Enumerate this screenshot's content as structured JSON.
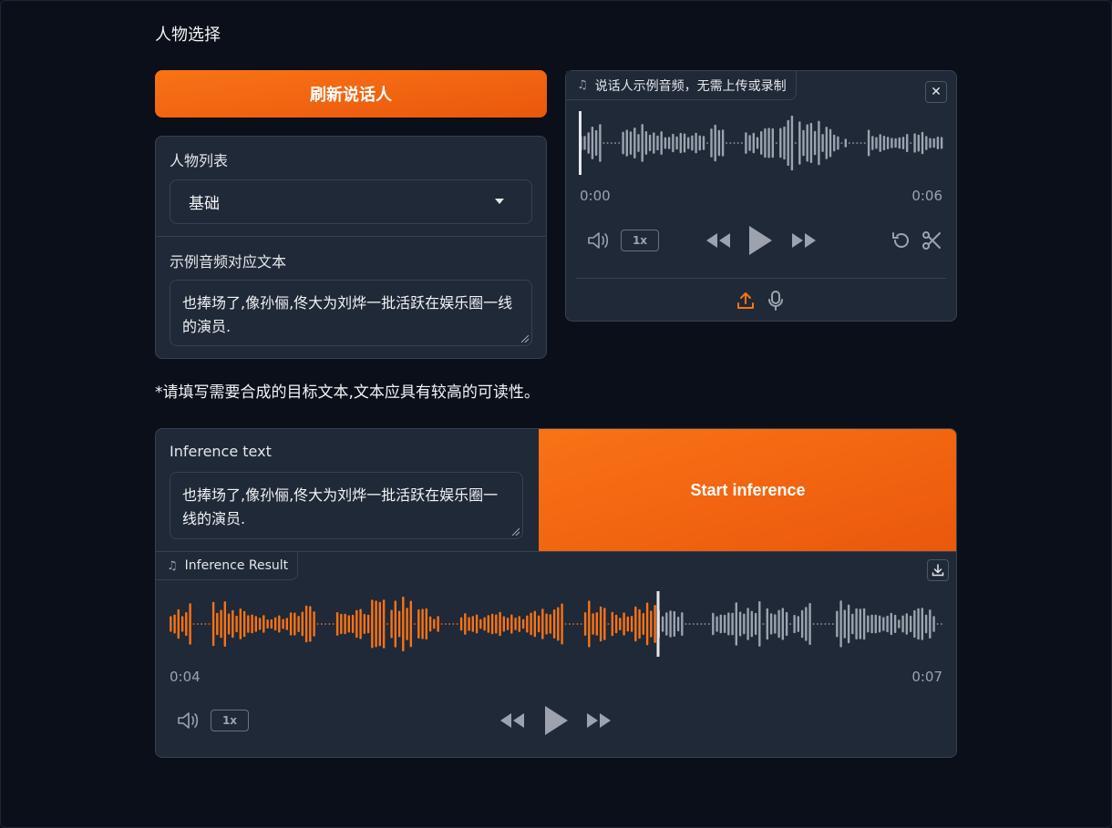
{
  "section_title": "人物选择",
  "refresh_button": "刷新说话人",
  "character_list": {
    "label": "人物列表",
    "selected": "基础"
  },
  "sample_text": {
    "label": "示例音频对应文本",
    "value": "也捧场了,像孙俪,佟大为刘烨一批活跃在娱乐圈一线的演员."
  },
  "sample_audio": {
    "tag_label": "说话人示例音频，无需上传或录制",
    "icon": "music-note-icon",
    "time_start": "0:00",
    "time_end": "0:06",
    "speed": "1x",
    "progress": 0.0
  },
  "hint_text": "*请填写需要合成的目标文本,文本应具有较高的可读性。",
  "inference": {
    "label": "Inference text",
    "value": "也捧场了,像孙俪,佟大为刘烨一批活跃在娱乐圈一线的演员.",
    "start_button": "Start inference",
    "result_label": "Inference Result",
    "time_current": "0:04",
    "time_end": "0:07",
    "speed": "1x",
    "progress": 0.63
  },
  "colors": {
    "accent": "#f97316",
    "wave_played": "#f97316",
    "wave_unplayed": "#9ca3af"
  }
}
